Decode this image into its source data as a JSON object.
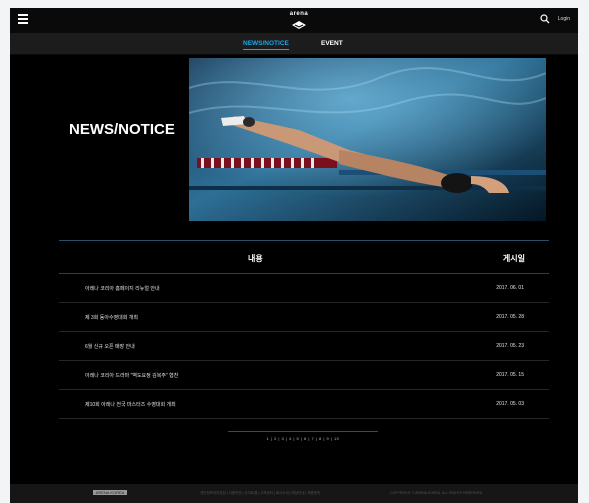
{
  "header": {
    "logo_text": "arena",
    "login_label": "Login"
  },
  "tabs": [
    {
      "label": "NEWS/NOTICE",
      "active": true
    },
    {
      "label": "EVENT",
      "active": false
    }
  ],
  "hero": {
    "title": "NEWS/NOTICE"
  },
  "table": {
    "col_content": "내용",
    "col_date": "게시일",
    "rows": [
      {
        "title": "아레나 코리아 홈페이지 리뉴얼 안내",
        "date": "2017. 06. 01"
      },
      {
        "title": "제 3회 동아수영대회 개최",
        "date": "2017. 05. 28"
      },
      {
        "title": "6월 신규 오픈 매장 안내",
        "date": "2017. 05. 23"
      },
      {
        "title": "아레나 코리아 드라마 \"역도요정 김복주\" 협찬",
        "date": "2017. 05. 15"
      },
      {
        "title": "제10회 아레나 전국 마스터즈 수영대회 개최",
        "date": "2017. 05. 03"
      }
    ]
  },
  "pagination": {
    "text": "1 | 2 | 3 | 4 | 5 | 6 | 7 | 8 | 9 | 10"
  },
  "footer": {
    "logo_text": "ARENA KOREA",
    "text_1": "개인정보처리방침 | 이용약관 | 사이트맵 | 고객센터 | 회사소개 | 매장안내 | 제휴문의",
    "text_2": "COPYRIGHT © ARENA KOREA. ALL RIGHTS RESERVED"
  },
  "colors": {
    "accent": "#1ba6e6",
    "background": "#000000"
  }
}
